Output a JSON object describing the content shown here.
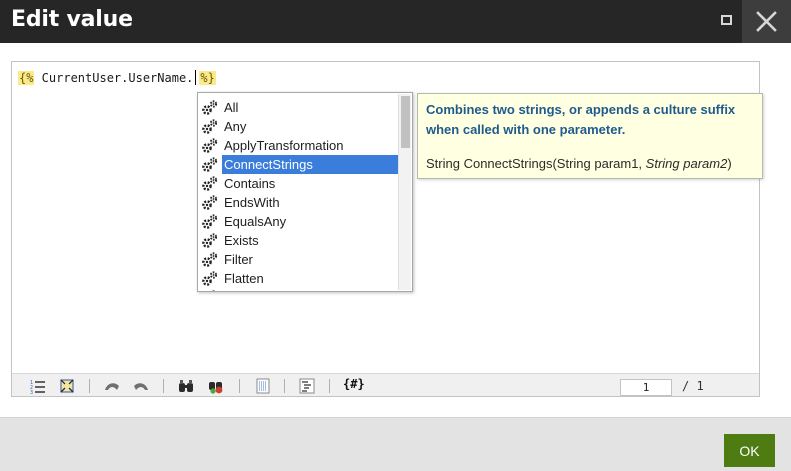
{
  "dialog": {
    "title": "Edit value",
    "ok_label": "OK"
  },
  "editor": {
    "open_tag": "{%",
    "expression": " CurrentUser.UserName.",
    "close_tag": "%}"
  },
  "autocomplete": {
    "items": [
      "All",
      "Any",
      "ApplyTransformation",
      "ConnectStrings",
      "Contains",
      "EndsWith",
      "EqualsAny",
      "Exists",
      "Filter",
      "Flatten"
    ],
    "selected": "ConnectStrings",
    "icon": "gears-icon"
  },
  "tooltip": {
    "description": "Combines two strings, or appends a culture suffix when called with one parameter.",
    "signature_prefix": "String ConnectStrings(String param1, ",
    "signature_param": "String param2",
    "signature_suffix": ")",
    "background": "#ffffe1",
    "text_color": "#1f5b8f"
  },
  "toolbar": {
    "icons": [
      "line-numbers-icon",
      "fullscreen-icon",
      "undo-icon",
      "redo-icon",
      "find-icon",
      "replace-icon",
      "format-icon",
      "indent-icon",
      "insert-macro-icon"
    ],
    "macro_label": "{#}",
    "page_current": "1",
    "page_total": "/ 1"
  },
  "colors": {
    "titlebar": "#262626",
    "selection": "#3b7ddb",
    "ok_button": "#4e7c12",
    "macro_highlight": "#fbe98c"
  }
}
